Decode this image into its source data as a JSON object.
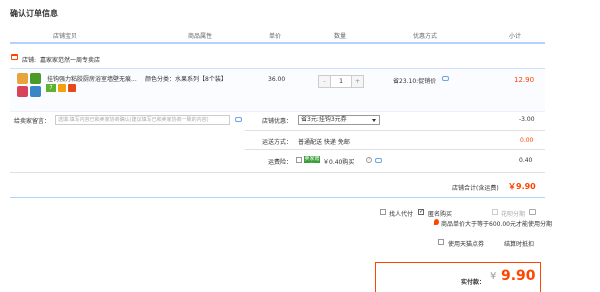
{
  "page": {
    "title": "确认订单信息"
  },
  "columns": [
    "店铺宝贝",
    "商品属性",
    "单价",
    "数量",
    "优惠方式",
    "小计"
  ],
  "store": {
    "label": "店铺:",
    "name": "嘉家家范然一周专卖店"
  },
  "item": {
    "name": "挂钩强力粘胶厨房浴室墙壁无痕...",
    "attr": "颜色分类：水果系列【8个装】",
    "price": "36.00",
    "qty": "1",
    "qty_minus": "-",
    "qty_plus": "+",
    "discount": "省23.10:促销价",
    "subtotal": "12.90"
  },
  "message": {
    "label": "给卖家留言：",
    "placeholder": "选填:填写内容已和卖家协商确认(建议填写已和卖家协商一致的内容)"
  },
  "store_promo": {
    "label": "店铺优惠：",
    "selected": "省3元:挂钩3元券",
    "value": "-3.00"
  },
  "shipping": {
    "label": "运送方式：",
    "text": "普通配送 快递 免邮",
    "value": "0.00"
  },
  "insurance": {
    "label": "运费险：",
    "tag": "卖家赠送",
    "text": "￥0.40购买",
    "help": "?",
    "value": "0.40"
  },
  "store_total": {
    "label": "店铺合计(含运费)",
    "value": "￥9.90"
  },
  "options": {
    "proxy_pay": "找人代付",
    "anonymous": "匿名购买",
    "installment": "花呗分期",
    "installment_note": "商品单价大于等于600.00元才能使用分期"
  },
  "coupon": {
    "label": "使用天猫点券",
    "link": "结算时抵扣"
  },
  "payment": {
    "label": "实付款：",
    "currency": "¥",
    "value": "9.90"
  },
  "colors": {
    "accent": "#ff4400",
    "border_blue": "#b2d1ff",
    "green": "#3a9d3a"
  }
}
